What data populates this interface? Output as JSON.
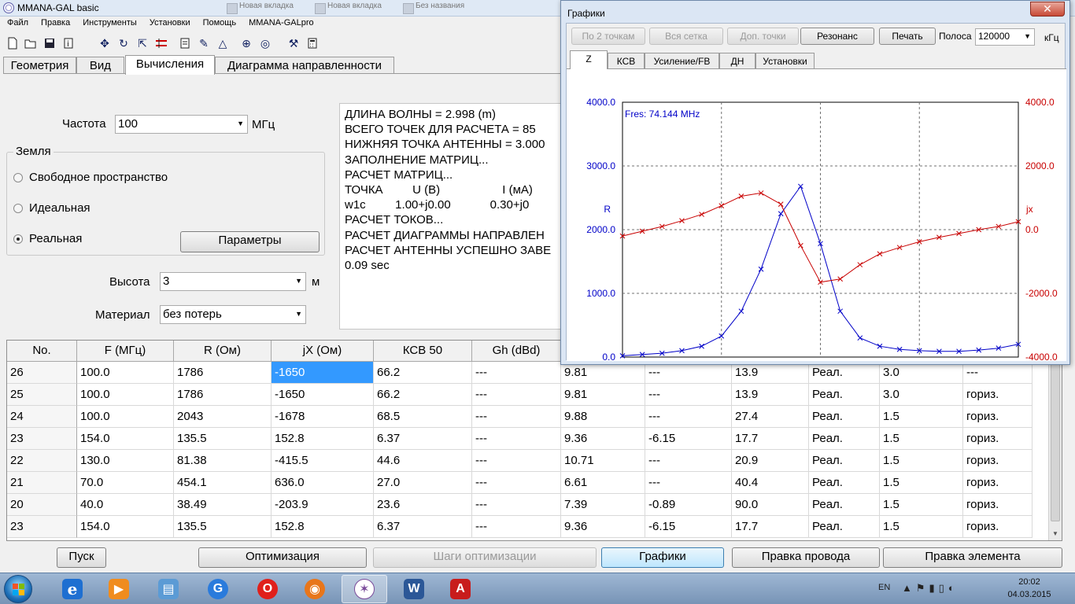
{
  "main_window": {
    "title": "MMANA-GAL basic"
  },
  "background_tabs": [
    "Новая вкладка",
    "Новая вкладка",
    "Без названия"
  ],
  "menu": [
    "Файл",
    "Правка",
    "Инструменты",
    "Установки",
    "Помощь",
    "MMANA-GALpro"
  ],
  "toolbar_icons": [
    "new-file",
    "open-folder",
    "save",
    "info",
    "move-cursor",
    "rotate",
    "stretch",
    "align",
    "document",
    "edit-pencil",
    "triangle",
    "crosshair",
    "target",
    "tools",
    "calculator"
  ],
  "tabs": [
    "Геометрия",
    "Вид",
    "Вычисления",
    "Диаграмма направленности"
  ],
  "active_tab": "Вычисления",
  "calc": {
    "freq_label": "Частота",
    "freq_value": "100",
    "freq_unit": "МГц",
    "ground_title": "Земля",
    "ground_options": [
      "Свободное пространство",
      "Идеальная",
      "Реальная"
    ],
    "ground_selected": "Реальная",
    "params_button": "Параметры",
    "height_label": "Высота",
    "height_value": "3",
    "height_unit": "м",
    "material_label": "Материал",
    "material_value": "без потерь"
  },
  "log_lines": [
    "ДЛИНА ВОЛНЫ = 2.998 (m)",
    "ВСЕГО ТОЧЕК ДЛЯ РАСЧЕТА = 85",
    "НИЖНЯЯ ТОЧКА АНТЕННЫ = 3.000",
    "ЗАПОЛНЕНИЕ МАТРИЦ...",
    "РАСЧЕТ МАТРИЦ...",
    "ТОЧКА         U (В)                   I (мА)",
    "w1c         1.00+j0.00            0.30+j0",
    "РАСЧЕТ ТОКОВ...",
    "РАСЧЕТ ДИАГРАММЫ НАПРАВЛЕН",
    "РАСЧЕТ АНТЕННЫ УСПЕШНО ЗАВЕ",
    "0.09 sec"
  ],
  "table": {
    "columns": [
      "No.",
      "F (МГц)",
      "R (Ом)",
      "jX (Ом)",
      "КСВ 50",
      "Gh (dBd)",
      "",
      "",
      "",
      "",
      "",
      ""
    ],
    "rows": [
      [
        "26",
        "100.0",
        "1786",
        "-1650",
        "66.2",
        "---",
        "9.81",
        "---",
        "13.9",
        "Реал.",
        "3.0",
        "---"
      ],
      [
        "25",
        "100.0",
        "1786",
        "-1650",
        "66.2",
        "---",
        "9.81",
        "---",
        "13.9",
        "Реал.",
        "3.0",
        "гориз."
      ],
      [
        "24",
        "100.0",
        "2043",
        "-1678",
        "68.5",
        "---",
        "9.88",
        "---",
        "27.4",
        "Реал.",
        "1.5",
        "гориз."
      ],
      [
        "23",
        "154.0",
        "135.5",
        "152.8",
        "6.37",
        "---",
        "9.36",
        "-6.15",
        "17.7",
        "Реал.",
        "1.5",
        "гориз."
      ],
      [
        "22",
        "130.0",
        "81.38",
        "-415.5",
        "44.6",
        "---",
        "10.71",
        "---",
        "20.9",
        "Реал.",
        "1.5",
        "гориз."
      ],
      [
        "21",
        "70.0",
        "454.1",
        "636.0",
        "27.0",
        "---",
        "6.61",
        "---",
        "40.4",
        "Реал.",
        "1.5",
        "гориз."
      ],
      [
        "20",
        "40.0",
        "38.49",
        "-203.9",
        "23.6",
        "---",
        "7.39",
        "-0.89",
        "90.0",
        "Реал.",
        "1.5",
        "гориз."
      ],
      [
        "23",
        "154.0",
        "135.5",
        "152.8",
        "6.37",
        "---",
        "9.36",
        "-6.15",
        "17.7",
        "Реал.",
        "1.5",
        "гориз."
      ]
    ],
    "selected": {
      "row": 0,
      "col": 3
    }
  },
  "bottom_buttons": [
    "Пуск",
    "Оптимизация",
    "Шаги оптимизации",
    "Графики",
    "Правка провода",
    "Правка элемента"
  ],
  "graph_window": {
    "title": "Графики",
    "close_label": "✕",
    "buttons": [
      "По 2 точкам",
      "Вся сетка",
      "Доп. точки",
      "Резонанс",
      "Печать"
    ],
    "band_label": "Полоса",
    "band_value": "120000",
    "band_unit": "кГц",
    "tabs": [
      "Z",
      "КСВ",
      "Усиление/FB",
      "ДН",
      "Установки"
    ],
    "active_tab": "Z",
    "colors": {
      "r_series": "#0000c8",
      "jx_series": "#c80000",
      "grid": "#707070"
    }
  },
  "chart_data": {
    "type": "line",
    "annotations": [
      "Fres: 74.144 MHz"
    ],
    "xlim": [
      40,
      160
    ],
    "x_ticks": [
      "40.0",
      "70.0",
      "100.0",
      "130.0",
      "160.0"
    ],
    "y_left": {
      "label": "R",
      "lim": [
        0,
        4000
      ],
      "ticks": [
        "0.0",
        "1000.0",
        "2000.0",
        "3000.0",
        "4000.0"
      ]
    },
    "y_right": {
      "label": "jx",
      "lim": [
        -4000,
        4000
      ],
      "ticks": [
        "-4000.0",
        "-2000.0",
        "0.0",
        "2000.0",
        "4000.0"
      ]
    },
    "grid": true,
    "series": [
      {
        "name": "R",
        "axis": "left",
        "x": [
          40,
          46,
          52,
          58,
          64,
          70,
          76,
          82,
          88,
          94,
          100,
          106,
          112,
          118,
          124,
          130,
          136,
          142,
          148,
          154,
          160
        ],
        "y": [
          20,
          40,
          60,
          100,
          170,
          330,
          720,
          1380,
          2250,
          2680,
          1780,
          720,
          300,
          170,
          120,
          100,
          90,
          90,
          110,
          140,
          200
        ]
      },
      {
        "name": "jx",
        "axis": "right",
        "x": [
          40,
          46,
          52,
          58,
          64,
          70,
          76,
          82,
          88,
          94,
          100,
          106,
          112,
          118,
          124,
          130,
          136,
          142,
          148,
          154,
          160
        ],
        "y": [
          -200,
          -50,
          100,
          280,
          480,
          750,
          1050,
          1150,
          800,
          -500,
          -1650,
          -1550,
          -1100,
          -760,
          -560,
          -380,
          -240,
          -120,
          0,
          100,
          250
        ]
      }
    ]
  },
  "taskbar": {
    "apps": [
      "explorer-shell",
      "internet-explorer",
      "media-player",
      "file-manager",
      "google-chrome",
      "opera",
      "firefox",
      "mmana-gal",
      "word",
      "pdf-reader"
    ],
    "active_app": "mmana-gal",
    "lang": "EN",
    "time": "20:02",
    "date": "04.03.2015"
  }
}
